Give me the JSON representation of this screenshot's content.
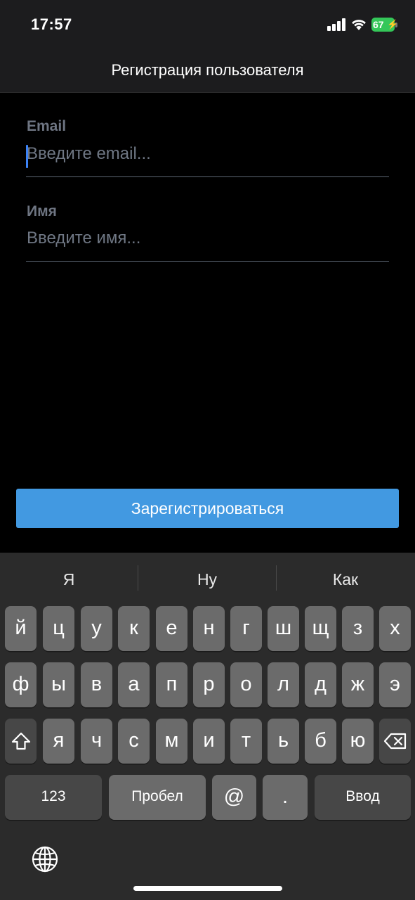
{
  "status_bar": {
    "time": "17:57",
    "battery_percent": "67",
    "battery_color": "#34c759",
    "icons": [
      "signal-icon",
      "wifi-icon",
      "battery-icon",
      "charging-bolt-icon"
    ]
  },
  "nav": {
    "title": "Регистрация пользователя"
  },
  "form": {
    "email": {
      "label": "Email",
      "placeholder": "Введите email...",
      "value": ""
    },
    "name": {
      "label": "Имя",
      "placeholder": "Введите имя...",
      "value": ""
    },
    "submit_label": "Зарегистрироваться"
  },
  "colors": {
    "accent": "#4299e1",
    "cursor": "#3b82f6",
    "label": "#6e7582"
  },
  "keyboard": {
    "suggestions": [
      "Я",
      "Ну",
      "Как"
    ],
    "row1": [
      "й",
      "ц",
      "у",
      "к",
      "е",
      "н",
      "г",
      "ш",
      "щ",
      "з",
      "х"
    ],
    "row2": [
      "ф",
      "ы",
      "в",
      "а",
      "п",
      "р",
      "о",
      "л",
      "д",
      "ж",
      "э"
    ],
    "row3": [
      "я",
      "ч",
      "с",
      "м",
      "и",
      "т",
      "ь",
      "б",
      "ю"
    ],
    "numbers_key": "123",
    "space_key": "Пробел",
    "at_key": "@",
    "dot_key": ".",
    "return_key": "Ввод",
    "icons": [
      "shift-icon",
      "backspace-icon",
      "globe-icon"
    ]
  }
}
